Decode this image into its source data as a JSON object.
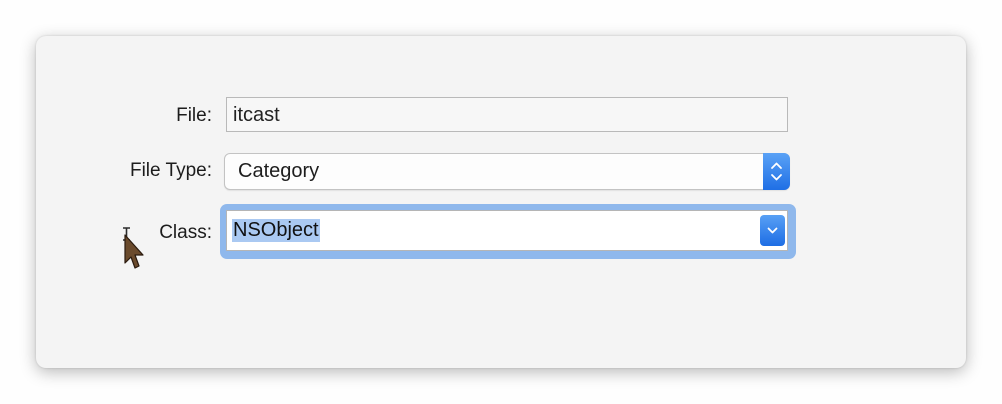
{
  "form": {
    "file_label": "File:",
    "file_value": "itcast",
    "file_type_label": "File Type:",
    "file_type_value": "Category",
    "class_label": "Class:",
    "class_value": "NSObject"
  },
  "icons": {
    "file_type_control": "up-down-chevron-icon",
    "class_control": "chevron-down-icon",
    "pointer": "mouse-cursor-icon"
  },
  "colors": {
    "accent": "#1f6fe5",
    "focus_ring": "#8fb8ec",
    "selection": "#aac9f2"
  }
}
